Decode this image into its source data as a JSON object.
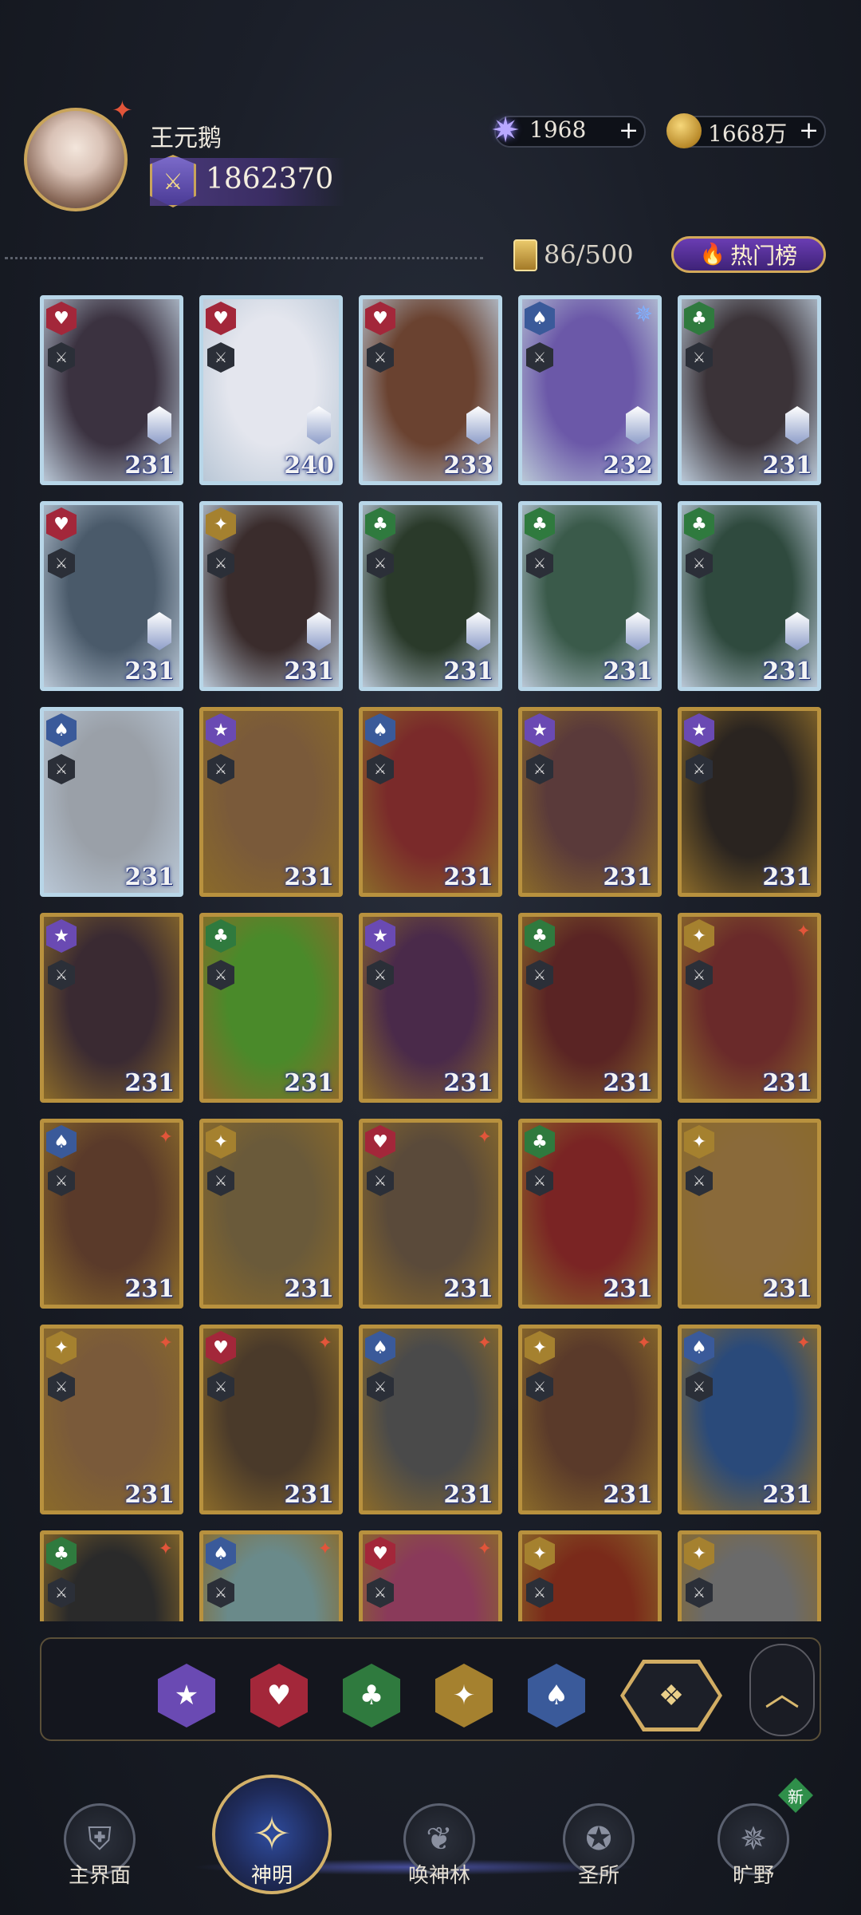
{
  "player": {
    "name": "王元鹅",
    "power": "1862370"
  },
  "currency": {
    "gems": "1968",
    "coins": "1668万",
    "plus": "+"
  },
  "collection": {
    "count": "86/500",
    "hot_button": "热门榜"
  },
  "colors": {
    "heart": "#a3273a",
    "club": "#2f7a3e",
    "diamond": "#a5812f",
    "spade": "#3a5a9a",
    "star": "#6a4ab3"
  },
  "cards": [
    {
      "level": "231",
      "suit": "heart",
      "frame": "holo",
      "portrait": "#3b3240"
    },
    {
      "level": "240",
      "suit": "heart",
      "frame": "holo",
      "portrait": "#e4e6ee"
    },
    {
      "level": "233",
      "suit": "heart",
      "frame": "holo",
      "portrait": "#6a4230"
    },
    {
      "level": "232",
      "suit": "spade",
      "frame": "holo",
      "portrait": "#6b58a8",
      "mark": "blue"
    },
    {
      "level": "231",
      "suit": "club",
      "frame": "holo",
      "portrait": "#3b3338"
    },
    {
      "level": "231",
      "suit": "heart",
      "frame": "holo",
      "portrait": "#4a5a6a"
    },
    {
      "level": "231",
      "suit": "diamond",
      "frame": "holo",
      "portrait": "#3a2c2c"
    },
    {
      "level": "231",
      "suit": "club",
      "frame": "holo",
      "portrait": "#2a3a2a"
    },
    {
      "level": "231",
      "suit": "club",
      "frame": "holo",
      "portrait": "#3a5a4a"
    },
    {
      "level": "231",
      "suit": "club",
      "frame": "holo",
      "portrait": "#2f4a3e"
    },
    {
      "level": "231",
      "suit": "spade",
      "frame": "holo",
      "portrait": "#9aa0a8"
    },
    {
      "level": "231",
      "suit": "star",
      "frame": "gold",
      "portrait": "#7a5a3a"
    },
    {
      "level": "231",
      "suit": "spade",
      "frame": "gold",
      "portrait": "#7a2a2a"
    },
    {
      "level": "231",
      "suit": "star",
      "frame": "gold",
      "portrait": "#5a3a3a"
    },
    {
      "level": "231",
      "suit": "star",
      "frame": "gold",
      "portrait": "#2a2420"
    },
    {
      "level": "231",
      "suit": "star",
      "frame": "gold",
      "portrait": "#3a2a32"
    },
    {
      "level": "231",
      "suit": "club",
      "frame": "gold",
      "portrait": "#4a8a2a"
    },
    {
      "level": "231",
      "suit": "star",
      "frame": "gold",
      "portrait": "#4a2a4a"
    },
    {
      "level": "231",
      "suit": "club",
      "frame": "gold",
      "portrait": "#5a2424"
    },
    {
      "level": "231",
      "suit": "diamond",
      "frame": "gold",
      "portrait": "#6a2a2a",
      "mark": "spark"
    },
    {
      "level": "231",
      "suit": "spade",
      "frame": "gold",
      "portrait": "#5a3a2a",
      "mark": "spark"
    },
    {
      "level": "231",
      "suit": "diamond",
      "frame": "gold",
      "portrait": "#6a5a3a"
    },
    {
      "level": "231",
      "suit": "heart",
      "frame": "gold",
      "portrait": "#5a4a3a",
      "mark": "spark"
    },
    {
      "level": "231",
      "suit": "club",
      "frame": "gold",
      "portrait": "#7a2424"
    },
    {
      "level": "231",
      "suit": "diamond",
      "frame": "gold",
      "portrait": "#8a6a3a"
    },
    {
      "level": "231",
      "suit": "diamond",
      "frame": "gold",
      "portrait": "#7a5a3a",
      "mark": "spark"
    },
    {
      "level": "231",
      "suit": "heart",
      "frame": "gold",
      "portrait": "#4a3a2a",
      "mark": "spark"
    },
    {
      "level": "231",
      "suit": "spade",
      "frame": "gold",
      "portrait": "#4a4a4a",
      "mark": "spark"
    },
    {
      "level": "231",
      "suit": "diamond",
      "frame": "gold",
      "portrait": "#5a3a2a",
      "mark": "spark"
    },
    {
      "level": "231",
      "suit": "spade",
      "frame": "gold",
      "portrait": "#2a4a7a",
      "mark": "spark"
    },
    {
      "level": "",
      "suit": "club",
      "frame": "gold",
      "portrait": "#2a2a2a",
      "mark": "spark"
    },
    {
      "level": "",
      "suit": "spade",
      "frame": "gold",
      "portrait": "#6a8a8a",
      "mark": "spark"
    },
    {
      "level": "",
      "suit": "heart",
      "frame": "gold",
      "portrait": "#8a3a5a",
      "mark": "spark"
    },
    {
      "level": "",
      "suit": "diamond",
      "frame": "gold",
      "portrait": "#7a2a1a"
    },
    {
      "level": "",
      "suit": "diamond",
      "frame": "gold",
      "portrait": "#6a6a6a"
    }
  ],
  "filters": [
    {
      "name": "star",
      "icon": "★",
      "color": "#6a4ab3"
    },
    {
      "name": "heart",
      "icon": "♥",
      "color": "#a3273a"
    },
    {
      "name": "club",
      "icon": "♣",
      "color": "#2f7a3e"
    },
    {
      "name": "diamond",
      "icon": "✦",
      "color": "#a5812f"
    },
    {
      "name": "spade",
      "icon": "♠",
      "color": "#3a5a9a"
    }
  ],
  "nav": {
    "home": "主界面",
    "gods": "神明",
    "grove": "唤神林",
    "sanctuary": "圣所",
    "wild": "旷野",
    "new_badge": "新"
  }
}
